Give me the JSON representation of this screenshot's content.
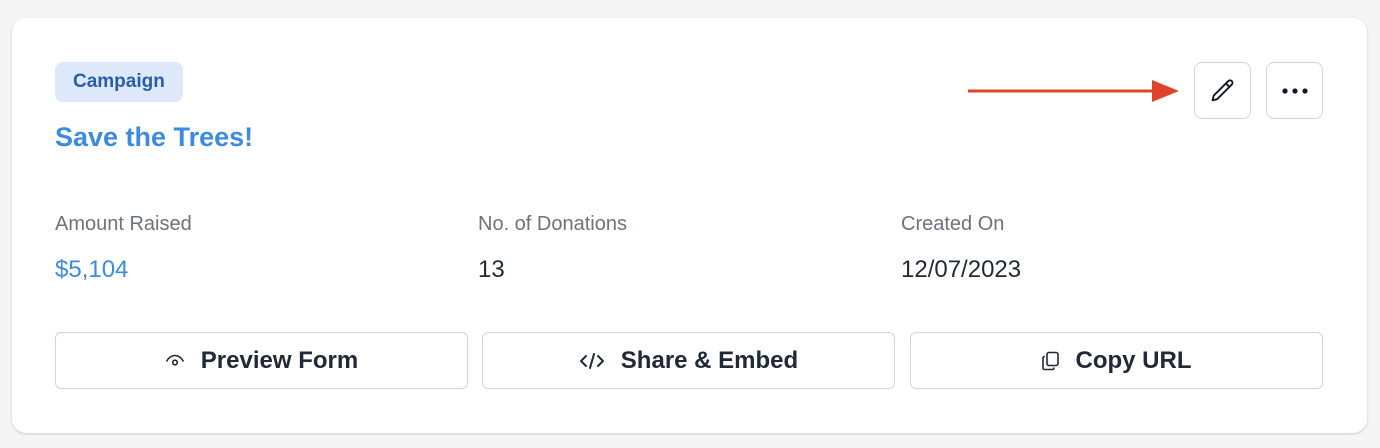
{
  "campaign": {
    "badge": "Campaign",
    "title": "Save the Trees!"
  },
  "toolbar": {
    "edit_icon": "pencil-icon",
    "more_icon": "ellipsis-icon"
  },
  "annotation": {
    "arrow_color": "#e0432b"
  },
  "stats": [
    {
      "label": "Amount Raised",
      "value": "$5,104"
    },
    {
      "label": "No. of Donations",
      "value": "13"
    },
    {
      "label": "Created On",
      "value": "12/07/2023"
    }
  ],
  "actions": [
    {
      "label": "Preview Form",
      "icon": "eye-icon"
    },
    {
      "label": "Share & Embed",
      "icon": "code-icon"
    },
    {
      "label": "Copy URL",
      "icon": "copy-icon"
    }
  ],
  "colors": {
    "accent": "#3d8be0",
    "badge_bg": "#dde9fb",
    "badge_text": "#2a5ea8"
  }
}
